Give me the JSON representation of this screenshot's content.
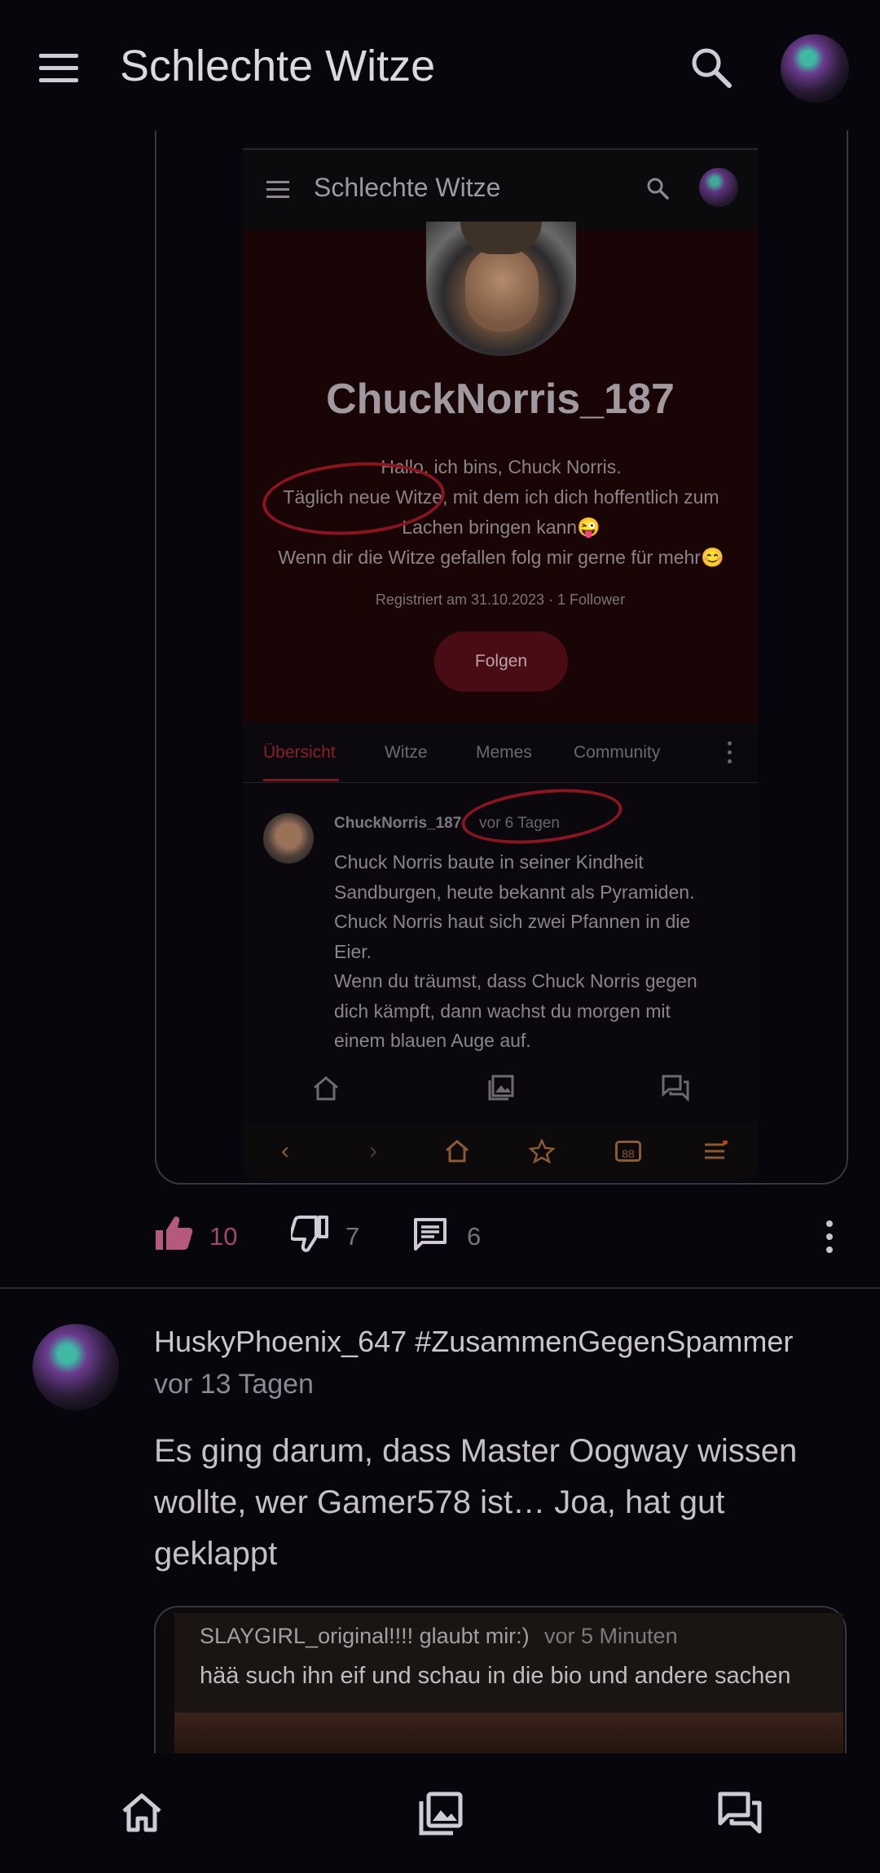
{
  "app": {
    "title": "Schlechte Witze"
  },
  "embedded": {
    "app_title": "Schlechte Witze",
    "username": "ChuckNorris_187",
    "bio_lines": [
      "Hallo, ich bins, Chuck Norris.",
      "Täglich neue Witze, mit dem ich dich hoffentlich zum",
      "Lachen bringen kann😜",
      "Wenn dir die Witze gefallen folg mir gerne für mehr😊"
    ],
    "registered": "Registriert am 31.10.2023 · 1 Follower",
    "follow_label": "Folgen",
    "tabs": [
      "Übersicht",
      "Witze",
      "Memes",
      "Community"
    ],
    "post": {
      "user": "ChuckNorris_187",
      "time": "vor 6 Tagen",
      "lines": [
        "Chuck Norris baute in seiner Kindheit",
        "Sandburgen, heute bekannt als Pyramiden.",
        "Chuck Norris haut sich zwei Pfannen in die",
        "Eier.",
        "Wenn du träumst, dass Chuck Norris gegen",
        "dich kämpft, dann wachst du morgen mit",
        "einem blauen Auge auf."
      ]
    },
    "browser_tab_count": "88"
  },
  "actions": {
    "likes": "10",
    "dislikes": "7",
    "comments": "6"
  },
  "post2": {
    "user": "HuskyPhoenix_647 #ZusammenGegenSpammer",
    "time": "vor 13 Tagen",
    "text_lines": [
      "Es ging darum, dass Master Oogway wissen",
      "wollte, wer Gamer578 ist… Joa, hat gut",
      "geklappt"
    ],
    "quoted": {
      "user": "SLAYGIRL_original!!!! glaubt mir:)",
      "time": "vor 5 Minuten",
      "text": "hää such ihn eif und schau in die bio und andere sachen"
    }
  },
  "colors": {
    "accent": "#a2496a",
    "background": "#08060d",
    "embedded_profile_bg": "#1a0506"
  }
}
